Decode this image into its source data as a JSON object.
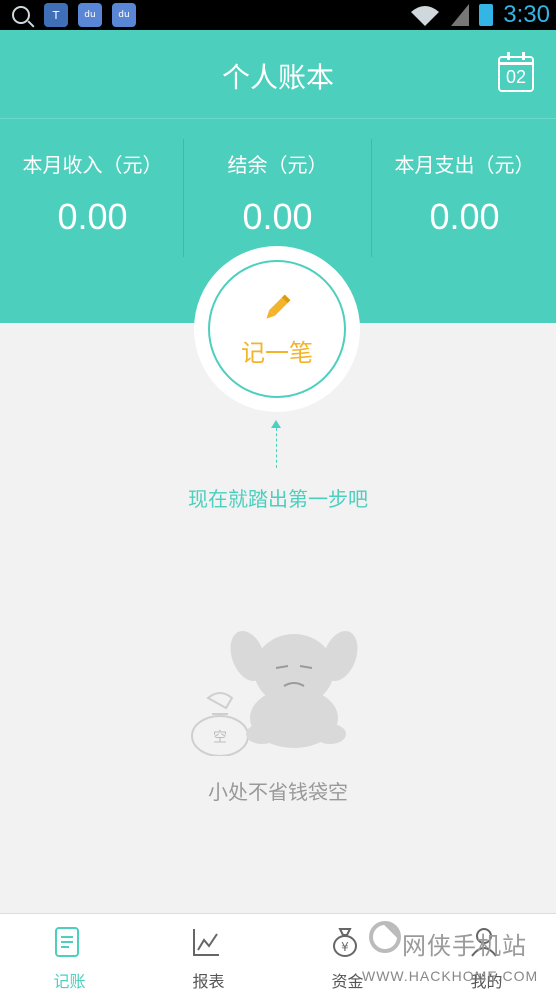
{
  "status_bar": {
    "time": "3:30",
    "icons": [
      "search-icon",
      "app-icon",
      "baidu-icon",
      "baidu-icon",
      "wifi-icon",
      "signal-icon",
      "battery-icon"
    ]
  },
  "header": {
    "title": "个人账本",
    "calendar_day": "02"
  },
  "summary": {
    "income_label": "本月收入（元）",
    "income_value": "0.00",
    "balance_label": "结余（元）",
    "balance_value": "0.00",
    "expense_label": "本月支出（元）",
    "expense_value": "0.00"
  },
  "record_button": {
    "label": "记一笔"
  },
  "hint": {
    "text": "现在就踏出第一步吧"
  },
  "empty_state": {
    "bag_text": "空",
    "text": "小处不省钱袋空"
  },
  "nav": {
    "items": [
      {
        "label": "记账",
        "icon": "ledger-icon",
        "active": true
      },
      {
        "label": "报表",
        "icon": "chart-icon",
        "active": false
      },
      {
        "label": "资金",
        "icon": "money-bag-icon",
        "active": false
      },
      {
        "label": "我的",
        "icon": "person-icon",
        "active": false
      }
    ]
  },
  "watermark": {
    "title": "网侠手机站",
    "url": "WWW.HACKHOME.COM"
  },
  "colors": {
    "primary": "#4dcfbd",
    "accent": "#f3b429",
    "status_time": "#33b5e5"
  }
}
